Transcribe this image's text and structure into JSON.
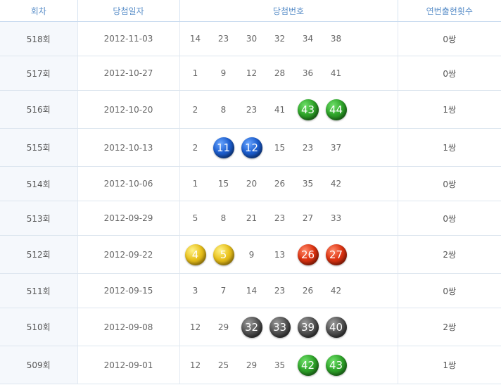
{
  "headers": {
    "round": "회차",
    "date": "당첨일자",
    "numbers": "당첨번호",
    "consecutive": "연번출현횟수"
  },
  "rows": [
    {
      "round": "518회",
      "date": "2012-11-03",
      "numbers": [
        {
          "v": "14"
        },
        {
          "v": "23"
        },
        {
          "v": "30"
        },
        {
          "v": "32"
        },
        {
          "v": "34"
        },
        {
          "v": "38"
        }
      ],
      "count": "0쌍"
    },
    {
      "round": "517회",
      "date": "2012-10-27",
      "numbers": [
        {
          "v": "1"
        },
        {
          "v": "9"
        },
        {
          "v": "12"
        },
        {
          "v": "28"
        },
        {
          "v": "36"
        },
        {
          "v": "41"
        }
      ],
      "count": "0쌍"
    },
    {
      "round": "516회",
      "date": "2012-10-20",
      "numbers": [
        {
          "v": "2"
        },
        {
          "v": "8"
        },
        {
          "v": "23"
        },
        {
          "v": "41"
        },
        {
          "v": "43",
          "ball": "green"
        },
        {
          "v": "44",
          "ball": "green"
        }
      ],
      "count": "1쌍"
    },
    {
      "round": "515회",
      "date": "2012-10-13",
      "numbers": [
        {
          "v": "2"
        },
        {
          "v": "11",
          "ball": "blue"
        },
        {
          "v": "12",
          "ball": "blue"
        },
        {
          "v": "15"
        },
        {
          "v": "23"
        },
        {
          "v": "37"
        }
      ],
      "count": "1쌍"
    },
    {
      "round": "514회",
      "date": "2012-10-06",
      "numbers": [
        {
          "v": "1"
        },
        {
          "v": "15"
        },
        {
          "v": "20"
        },
        {
          "v": "26"
        },
        {
          "v": "35"
        },
        {
          "v": "42"
        }
      ],
      "count": "0쌍"
    },
    {
      "round": "513회",
      "date": "2012-09-29",
      "numbers": [
        {
          "v": "5"
        },
        {
          "v": "8"
        },
        {
          "v": "21"
        },
        {
          "v": "23"
        },
        {
          "v": "27"
        },
        {
          "v": "33"
        }
      ],
      "count": "0쌍"
    },
    {
      "round": "512회",
      "date": "2012-09-22",
      "numbers": [
        {
          "v": "4",
          "ball": "yellow"
        },
        {
          "v": "5",
          "ball": "yellow"
        },
        {
          "v": "9"
        },
        {
          "v": "13"
        },
        {
          "v": "26",
          "ball": "red"
        },
        {
          "v": "27",
          "ball": "red"
        }
      ],
      "count": "2쌍"
    },
    {
      "round": "511회",
      "date": "2012-09-15",
      "numbers": [
        {
          "v": "3"
        },
        {
          "v": "7"
        },
        {
          "v": "14"
        },
        {
          "v": "23"
        },
        {
          "v": "26"
        },
        {
          "v": "42"
        }
      ],
      "count": "0쌍"
    },
    {
      "round": "510회",
      "date": "2012-09-08",
      "numbers": [
        {
          "v": "12"
        },
        {
          "v": "29"
        },
        {
          "v": "32",
          "ball": "gray"
        },
        {
          "v": "33",
          "ball": "gray"
        },
        {
          "v": "39",
          "ball": "gray"
        },
        {
          "v": "40",
          "ball": "gray"
        }
      ],
      "count": "2쌍"
    },
    {
      "round": "509회",
      "date": "2012-09-01",
      "numbers": [
        {
          "v": "12"
        },
        {
          "v": "25"
        },
        {
          "v": "29"
        },
        {
          "v": "35"
        },
        {
          "v": "42",
          "ball": "green"
        },
        {
          "v": "43",
          "ball": "green"
        }
      ],
      "count": "1쌍"
    }
  ]
}
